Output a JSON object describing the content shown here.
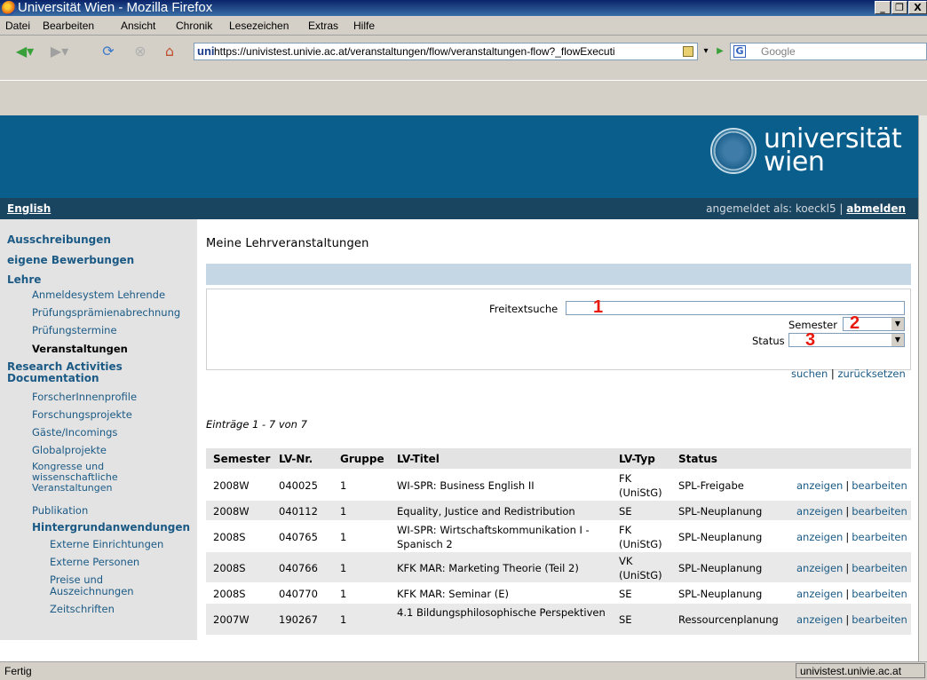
{
  "window": {
    "title": "Universität Wien - Mozilla Firefox",
    "controls": [
      "_",
      "❐",
      "X"
    ]
  },
  "menubar": [
    "Datei",
    "Bearbeiten",
    "Ansicht",
    "Chronik",
    "Lesezeichen",
    "Extras",
    "Hilfe"
  ],
  "toolbar": {
    "url": "https://univistest.univie.ac.at/veranstaltungen/flow/veranstaltungen-flow?_flowExecuti",
    "site_icon_text": "uni",
    "search_placeholder": "Google",
    "search_engine_icon": "G"
  },
  "header": {
    "logo_line1": "universität",
    "logo_line2": "wien",
    "language_link": "English",
    "logged_in_prefix": "angemeldet als: koeckl5 |",
    "logout_link": "abmelden"
  },
  "sidebar": {
    "items": [
      {
        "label": "Ausschreibungen"
      },
      {
        "label": "eigene Bewerbungen"
      },
      {
        "label": "Lehre"
      },
      {
        "label": "Anmeldesystem Lehrende"
      },
      {
        "label": "Prüfungsprämienabrechnung"
      },
      {
        "label": "Prüfungstermine"
      },
      {
        "label": "Veranstaltungen"
      },
      {
        "label": "Research Activities Documentation"
      },
      {
        "label": "ForscherInnenprofile"
      },
      {
        "label": "Forschungsprojekte"
      },
      {
        "label": "Gäste/Incomings"
      },
      {
        "label": "Globalprojekte"
      },
      {
        "label": "Kongresse und wissenschaftliche Veranstaltungen"
      },
      {
        "label": "Publikation"
      },
      {
        "label": "Hintergrundanwendungen"
      },
      {
        "label": "Externe Einrichtungen"
      },
      {
        "label": "Externe Personen"
      },
      {
        "label": "Preise und Auszeichnungen"
      },
      {
        "label": "Zeitschriften"
      }
    ]
  },
  "main": {
    "title": "Meine Lehrveranstaltungen",
    "search": {
      "freitext_label": "Freitextsuche",
      "freitext_value": "",
      "semester_label": "Semester",
      "semester_value": "",
      "status_label": "Status",
      "status_value": "",
      "markers": [
        "1",
        "2",
        "3"
      ],
      "search_link": "suchen",
      "separator": "|",
      "reset_link": "zurücksetzen"
    },
    "entries_text": "Einträge 1 - 7 von 7",
    "table": {
      "headers": [
        "Semester",
        "LV-Nr.",
        "Gruppe",
        "LV-Titel",
        "LV-Typ",
        "Status",
        ""
      ],
      "rows": [
        {
          "semester": "2008W",
          "nr": "040025",
          "gruppe": "1",
          "titel": "WI-SPR: Business English II",
          "typ": "FK (UniStG)",
          "status": "SPL-Freigabe"
        },
        {
          "semester": "2008W",
          "nr": "040112",
          "gruppe": "1",
          "titel": "Equality, Justice and Redistribution",
          "typ": "SE",
          "status": "SPL-Neuplanung"
        },
        {
          "semester": "2008S",
          "nr": "040765",
          "gruppe": "1",
          "titel": "WI-SPR: Wirtschaftskommunikation I - Spanisch 2",
          "typ": "FK (UniStG)",
          "status": "SPL-Neuplanung"
        },
        {
          "semester": "2008S",
          "nr": "040766",
          "gruppe": "1",
          "titel": "KFK MAR: Marketing Theorie (Teil 2)",
          "typ": "VK (UniStG)",
          "status": "SPL-Neuplanung"
        },
        {
          "semester": "2008S",
          "nr": "040770",
          "gruppe": "1",
          "titel": "KFK MAR: Seminar (E)",
          "typ": "SE",
          "status": "SPL-Neuplanung"
        },
        {
          "semester": "2007W",
          "nr": "190267",
          "gruppe": "1",
          "titel": "4.1 Bildungsphilosophische Perspektiven",
          "typ": "SE",
          "status": "Ressourcenplanung"
        }
      ],
      "action_view": "anzeigen",
      "action_sep": "|",
      "action_edit": "bearbeiten"
    }
  },
  "statusbar": {
    "text": "Fertig",
    "host": "univistest.univie.ac.at"
  },
  "colors": {
    "banner": "#0a5e8c",
    "subbar": "#1a4560",
    "link": "#1b5a85",
    "marker_red": "#e8190e",
    "row_alt": "#e9e9e9"
  }
}
